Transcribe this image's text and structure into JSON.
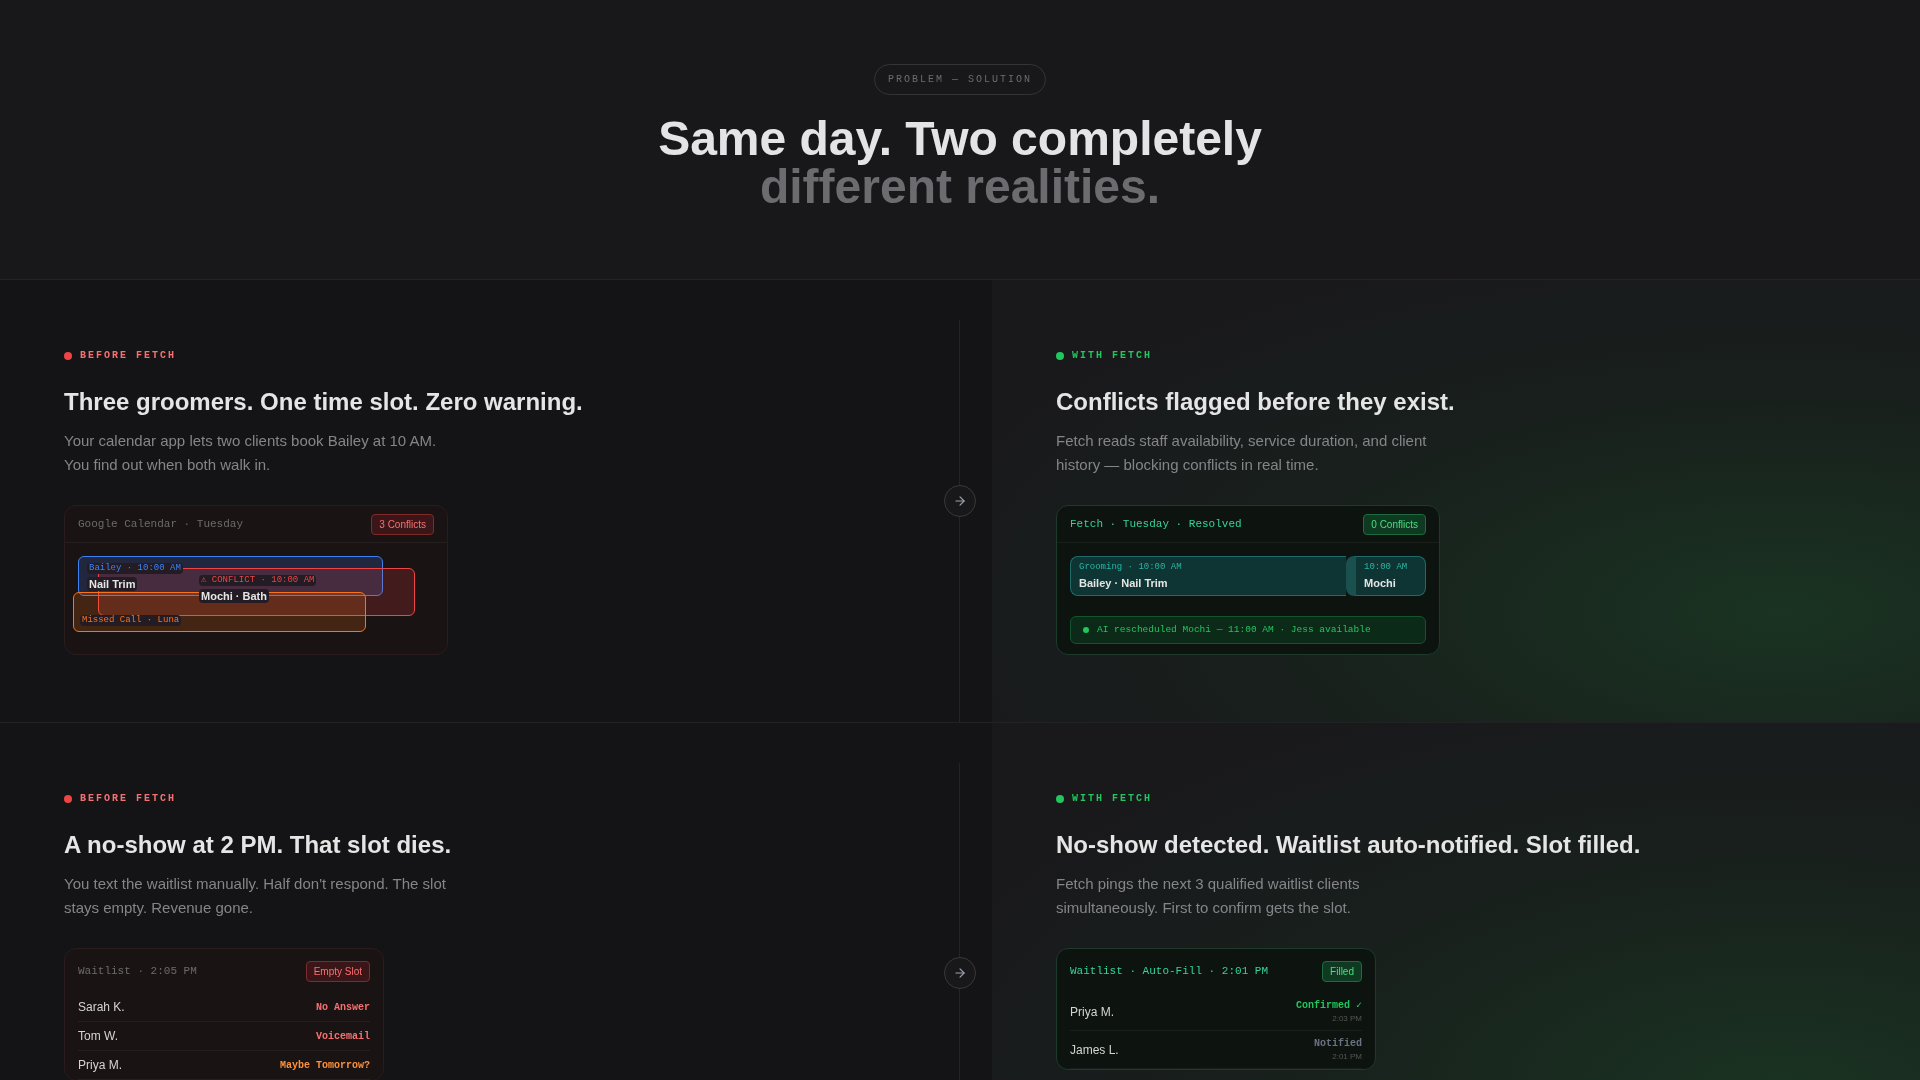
{
  "header": {
    "badge": "PROBLEM — SOLUTION",
    "title": "Same day. Two completely",
    "subtitle": "different realities."
  },
  "rows": [
    {
      "before": {
        "kind": "before",
        "label": "BEFORE FETCH",
        "heading": "Three groomers. One time slot. Zero warning.",
        "description": "Your calendar app lets two clients book Bailey at 10 AM. You find out when both walk in.",
        "card": {
          "kind": "calendar",
          "title": "Google Calendar · Tuesday",
          "badge": "3 Conflicts",
          "events": [
            {
              "meta": "Bailey · 10:00 AM",
              "name": "Nail Trim",
              "color": "#3b82f6"
            },
            {
              "meta": "⚠ CONFLICT · 10:00 AM",
              "name": "Mochi · Bath",
              "color": "#ef4444"
            },
            {
              "meta": "Missed Call · Luna",
              "color": "#f97316"
            }
          ]
        }
      },
      "after": {
        "kind": "after",
        "label": "WITH FETCH",
        "heading": "Conflicts flagged before they exist.",
        "description": "Fetch reads staff availability, service duration, and client history — blocking conflicts in real time.",
        "card": {
          "kind": "resolved",
          "title": "Fetch · Tuesday · Resolved",
          "badge": "0 Conflicts",
          "events": [
            {
              "meta": "Grooming · 10:00 AM",
              "name": "Bailey · Nail Trim"
            },
            {
              "meta": "10:00 AM",
              "name": "Mochi"
            }
          ],
          "note": "AI rescheduled Mochi — 11:00 AM · Jess available"
        }
      }
    },
    {
      "before": {
        "kind": "before",
        "label": "BEFORE FETCH",
        "heading": "A no-show at 2 PM. That slot dies.",
        "description": "You text the waitlist manually. Half don't respond. The slot stays empty. Revenue gone.",
        "card": {
          "kind": "waitlist",
          "title": "Waitlist · 2:05 PM",
          "badge": "Empty Slot",
          "entries": [
            {
              "name": "Sarah K.",
              "status": "No Answer",
              "color": "#f87171"
            },
            {
              "name": "Tom W.",
              "status": "Voicemail",
              "color": "#f87171"
            },
            {
              "name": "Priya M.",
              "status": "Maybe Tomorrow?",
              "color": "#fb923c"
            }
          ]
        }
      },
      "after": {
        "kind": "after",
        "label": "WITH FETCH",
        "heading": "No-show detected. Waitlist auto-notified. Slot filled.",
        "description": "Fetch pings the next 3 qualified waitlist clients simultaneously. First to confirm gets the slot.",
        "card": {
          "kind": "waitlist",
          "title": "Waitlist · Auto-Fill · 2:01 PM",
          "badge": "Filled",
          "entries": [
            {
              "name": "Priya M.",
              "status": "Confirmed ✓",
              "time": "2:03 PM",
              "color": "#22c55e"
            },
            {
              "name": "James L.",
              "status": "Notified",
              "time": "2:01 PM",
              "color": "#6b7280"
            }
          ]
        }
      }
    }
  ]
}
